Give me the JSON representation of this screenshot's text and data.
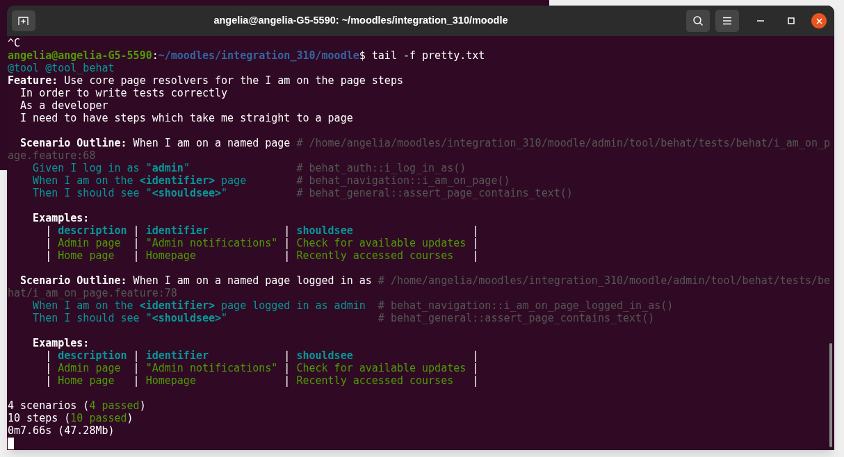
{
  "window": {
    "title": "angelia@angelia-G5-5590: ~/moodles/integration_310/moodle"
  },
  "terminal": {
    "lines": [
      {
        "kind": "text",
        "segments": [
          {
            "kind": "plain",
            "text": "^C"
          }
        ]
      },
      {
        "kind": "text",
        "segments": [
          {
            "kind": "prompt_user",
            "text": "angelia@angelia-G5-5590"
          },
          {
            "kind": "plain",
            "text": ":"
          },
          {
            "kind": "prompt_path",
            "text": "~/moodles/integration_310/moodle"
          },
          {
            "kind": "plain",
            "text": "$ tail -f pretty.txt"
          }
        ]
      },
      {
        "kind": "text",
        "segments": [
          {
            "kind": "tag",
            "text": "@tool @tool_behat"
          }
        ]
      },
      {
        "kind": "text",
        "segments": [
          {
            "kind": "bold",
            "text": "Feature:"
          },
          {
            "kind": "plain",
            "text": " Use core page resolvers for the I am on the page steps"
          }
        ]
      },
      {
        "kind": "text",
        "segments": [
          {
            "kind": "plain",
            "text": "  In order to write tests correctly"
          }
        ]
      },
      {
        "kind": "text",
        "segments": [
          {
            "kind": "plain",
            "text": "  As a developer"
          }
        ]
      },
      {
        "kind": "text",
        "segments": [
          {
            "kind": "plain",
            "text": "  I need to have steps which take me straight to a page"
          }
        ]
      },
      {
        "kind": "blank"
      },
      {
        "kind": "text",
        "segments": [
          {
            "kind": "bold",
            "text": "  Scenario Outline:"
          },
          {
            "kind": "plain",
            "text": " When I am on a named page "
          },
          {
            "kind": "comment",
            "text": "# /home/angelia/moodles/integration_310/moodle/admin/tool/behat/tests/behat/i_am_on_p"
          }
        ]
      },
      {
        "kind": "text",
        "segments": [
          {
            "kind": "comment",
            "text": "age.feature:68"
          }
        ]
      },
      {
        "kind": "text",
        "segments": [
          {
            "kind": "step",
            "text": "    Given I log in as \""
          },
          {
            "kind": "step_bold",
            "text": "admin"
          },
          {
            "kind": "step",
            "text": "\"                 "
          },
          {
            "kind": "comment",
            "text": "# behat_auth::i_log_in_as()"
          }
        ]
      },
      {
        "kind": "text",
        "segments": [
          {
            "kind": "step",
            "text": "    When I am on the "
          },
          {
            "kind": "step_bold",
            "text": "<identifier>"
          },
          {
            "kind": "step",
            "text": " page        "
          },
          {
            "kind": "comment",
            "text": "# behat_navigation::i_am_on_page()"
          }
        ]
      },
      {
        "kind": "text",
        "segments": [
          {
            "kind": "step",
            "text": "    Then I should see \""
          },
          {
            "kind": "step_bold",
            "text": "<shouldsee>"
          },
          {
            "kind": "step",
            "text": "\"           "
          },
          {
            "kind": "comment",
            "text": "# behat_general::assert_page_contains_text()"
          }
        ]
      },
      {
        "kind": "blank"
      },
      {
        "kind": "text",
        "segments": [
          {
            "kind": "bold",
            "text": "    Examples:"
          }
        ]
      },
      {
        "kind": "text",
        "segments": [
          {
            "kind": "plain",
            "text": "      | "
          },
          {
            "kind": "table_head",
            "text": "description"
          },
          {
            "kind": "plain",
            "text": " | "
          },
          {
            "kind": "table_head",
            "text": "identifier           "
          },
          {
            "kind": "plain",
            "text": " | "
          },
          {
            "kind": "table_head",
            "text": "shouldsee                  "
          },
          {
            "kind": "plain",
            "text": " |"
          }
        ]
      },
      {
        "kind": "text",
        "segments": [
          {
            "kind": "plain",
            "text": "      | "
          },
          {
            "kind": "passed",
            "text": "Admin page "
          },
          {
            "kind": "plain",
            "text": " | "
          },
          {
            "kind": "passed",
            "text": "\"Admin notifications\""
          },
          {
            "kind": "plain",
            "text": " | "
          },
          {
            "kind": "passed",
            "text": "Check for available updates"
          },
          {
            "kind": "plain",
            "text": " |"
          }
        ]
      },
      {
        "kind": "text",
        "segments": [
          {
            "kind": "plain",
            "text": "      | "
          },
          {
            "kind": "passed",
            "text": "Home page  "
          },
          {
            "kind": "plain",
            "text": " | "
          },
          {
            "kind": "passed",
            "text": "Homepage             "
          },
          {
            "kind": "plain",
            "text": " | "
          },
          {
            "kind": "passed",
            "text": "Recently accessed courses  "
          },
          {
            "kind": "plain",
            "text": " |"
          }
        ]
      },
      {
        "kind": "blank"
      },
      {
        "kind": "text",
        "segments": [
          {
            "kind": "bold",
            "text": "  Scenario Outline:"
          },
          {
            "kind": "plain",
            "text": " When I am on a named page logged in as "
          },
          {
            "kind": "comment",
            "text": "# /home/angelia/moodles/integration_310/moodle/admin/tool/behat/tests/be"
          }
        ]
      },
      {
        "kind": "text",
        "segments": [
          {
            "kind": "comment",
            "text": "hat/i_am_on_page.feature:78"
          }
        ]
      },
      {
        "kind": "text",
        "segments": [
          {
            "kind": "step",
            "text": "    When I am on the "
          },
          {
            "kind": "step_bold",
            "text": "<identifier>"
          },
          {
            "kind": "step",
            "text": " page logged in as admin  "
          },
          {
            "kind": "comment",
            "text": "# behat_navigation::i_am_on_page_logged_in_as()"
          }
        ]
      },
      {
        "kind": "text",
        "segments": [
          {
            "kind": "step",
            "text": "    Then I should see \""
          },
          {
            "kind": "step_bold",
            "text": "<shouldsee>"
          },
          {
            "kind": "step",
            "text": "\"                        "
          },
          {
            "kind": "comment",
            "text": "# behat_general::assert_page_contains_text()"
          }
        ]
      },
      {
        "kind": "blank"
      },
      {
        "kind": "text",
        "segments": [
          {
            "kind": "bold",
            "text": "    Examples:"
          }
        ]
      },
      {
        "kind": "text",
        "segments": [
          {
            "kind": "plain",
            "text": "      | "
          },
          {
            "kind": "table_head",
            "text": "description"
          },
          {
            "kind": "plain",
            "text": " | "
          },
          {
            "kind": "table_head",
            "text": "identifier           "
          },
          {
            "kind": "plain",
            "text": " | "
          },
          {
            "kind": "table_head",
            "text": "shouldsee                  "
          },
          {
            "kind": "plain",
            "text": " |"
          }
        ]
      },
      {
        "kind": "text",
        "segments": [
          {
            "kind": "plain",
            "text": "      | "
          },
          {
            "kind": "passed",
            "text": "Admin page "
          },
          {
            "kind": "plain",
            "text": " | "
          },
          {
            "kind": "passed",
            "text": "\"Admin notifications\""
          },
          {
            "kind": "plain",
            "text": " | "
          },
          {
            "kind": "passed",
            "text": "Check for available updates"
          },
          {
            "kind": "plain",
            "text": " |"
          }
        ]
      },
      {
        "kind": "text",
        "segments": [
          {
            "kind": "plain",
            "text": "      | "
          },
          {
            "kind": "passed",
            "text": "Home page  "
          },
          {
            "kind": "plain",
            "text": " | "
          },
          {
            "kind": "passed",
            "text": "Homepage             "
          },
          {
            "kind": "plain",
            "text": " | "
          },
          {
            "kind": "passed",
            "text": "Recently accessed courses  "
          },
          {
            "kind": "plain",
            "text": " |"
          }
        ]
      },
      {
        "kind": "blank"
      },
      {
        "kind": "text",
        "segments": [
          {
            "kind": "plain",
            "text": "4 scenarios ("
          },
          {
            "kind": "passed",
            "text": "4 passed"
          },
          {
            "kind": "plain",
            "text": ")"
          }
        ]
      },
      {
        "kind": "text",
        "segments": [
          {
            "kind": "plain",
            "text": "10 steps ("
          },
          {
            "kind": "passed",
            "text": "10 passed"
          },
          {
            "kind": "plain",
            "text": ")"
          }
        ]
      },
      {
        "kind": "text",
        "segments": [
          {
            "kind": "plain",
            "text": "0m7.66s (47.28Mb)"
          }
        ]
      }
    ]
  }
}
